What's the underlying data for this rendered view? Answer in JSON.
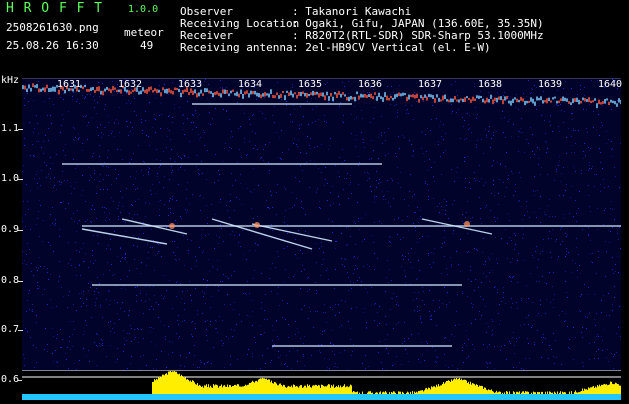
{
  "header": {
    "app_name": "H R O F F T",
    "version": "1.0.0",
    "filename": "2508261630.png",
    "datetime": "25.08.26 16:30",
    "meteor_label": "meteor",
    "meteor_count": "49",
    "fields": [
      {
        "label": "Observer",
        "value": ": Takanori Kawachi"
      },
      {
        "label": "Receiving Location",
        "value": ": Ogaki, Gifu, JAPAN (136.60E, 35.35N)"
      },
      {
        "label": "Receiver",
        "value": ": R820T2(RTL-SDR) SDR-Sharp 53.1000MHz"
      },
      {
        "label": "Receiving antenna",
        "value": ": 2el-HB9CV Vertical (el. E-W)"
      }
    ]
  },
  "spectrogram": {
    "y_unit": "kHz",
    "y_ticks": [
      "1.1",
      "1.0",
      "0.9",
      "0.8",
      "0.7",
      "0.6"
    ],
    "minute_labels": [
      "1631",
      "1632",
      "1633",
      "1634",
      "1635",
      "1636",
      "1637",
      "1638",
      "1639",
      "1640"
    ],
    "colors": {
      "background": "#02032a",
      "noise": "#1a2cff",
      "echo": "#cfe8ff",
      "bar": "#ffee00",
      "floor": "#23c7ff"
    }
  }
}
